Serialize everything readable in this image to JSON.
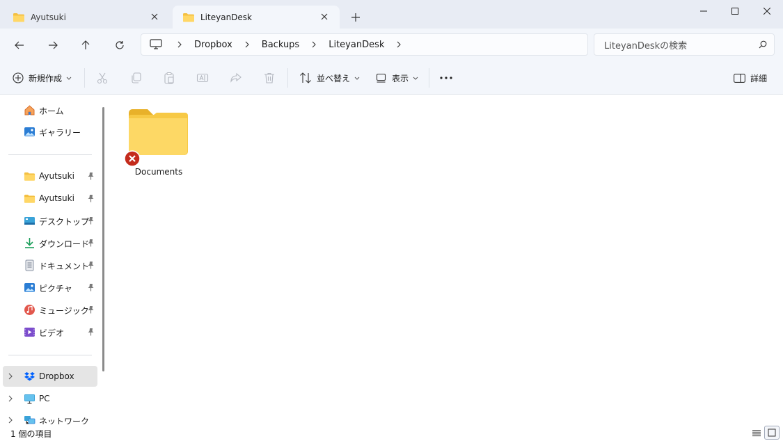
{
  "tabs": [
    {
      "label": "Ayutsuki",
      "icon": "folder-icon",
      "active": false
    },
    {
      "label": "LiteyanDesk",
      "icon": "folder-icon",
      "active": true
    }
  ],
  "window_controls": [
    "minimize-icon",
    "maximize-icon",
    "close-icon"
  ],
  "breadcrumb": [
    "Dropbox",
    "Backups",
    "LiteyanDesk"
  ],
  "search": {
    "placeholder": "LiteyanDeskの検索"
  },
  "toolbar": {
    "new_label": "新規作成",
    "sort_label": "並べ替え",
    "view_label": "表示",
    "details_label": "詳細",
    "icons": [
      "cut-icon",
      "copy-icon",
      "paste-icon",
      "rename-icon",
      "share-icon",
      "delete-icon",
      "more-icon"
    ]
  },
  "sidebar": {
    "quick": [
      {
        "label": "ホーム",
        "icon": "home-icon"
      },
      {
        "label": "ギャラリー",
        "icon": "gallery-icon"
      }
    ],
    "pinned": [
      {
        "label": "Ayutsuki",
        "icon": "folder-icon"
      },
      {
        "label": "Ayutsuki",
        "icon": "folder-icon"
      },
      {
        "label": "デスクトップ",
        "icon": "desktop-icon"
      },
      {
        "label": "ダウンロード",
        "icon": "download-icon"
      },
      {
        "label": "ドキュメント",
        "icon": "document-icon"
      },
      {
        "label": "ピクチャ",
        "icon": "pictures-icon"
      },
      {
        "label": "ミュージック",
        "icon": "music-icon"
      },
      {
        "label": "ビデオ",
        "icon": "video-icon"
      }
    ],
    "tree": [
      {
        "label": "Dropbox",
        "icon": "dropbox-icon",
        "selected": true
      },
      {
        "label": "PC",
        "icon": "pc-icon",
        "selected": false
      },
      {
        "label": "ネットワーク",
        "icon": "network-icon",
        "selected": false
      }
    ]
  },
  "content": {
    "items": [
      {
        "name": "Documents",
        "icon": "folder-icon",
        "badge": "sync-error-icon"
      }
    ]
  },
  "status": {
    "text": "1 個の項目"
  },
  "colors": {
    "titlebar_bg": "#e8ecf4",
    "toolbar_bg": "#f3f6fb",
    "folder_yellow": "#f7c945",
    "error_red": "#c42b1c",
    "selected_bg": "#e5e5e5"
  }
}
